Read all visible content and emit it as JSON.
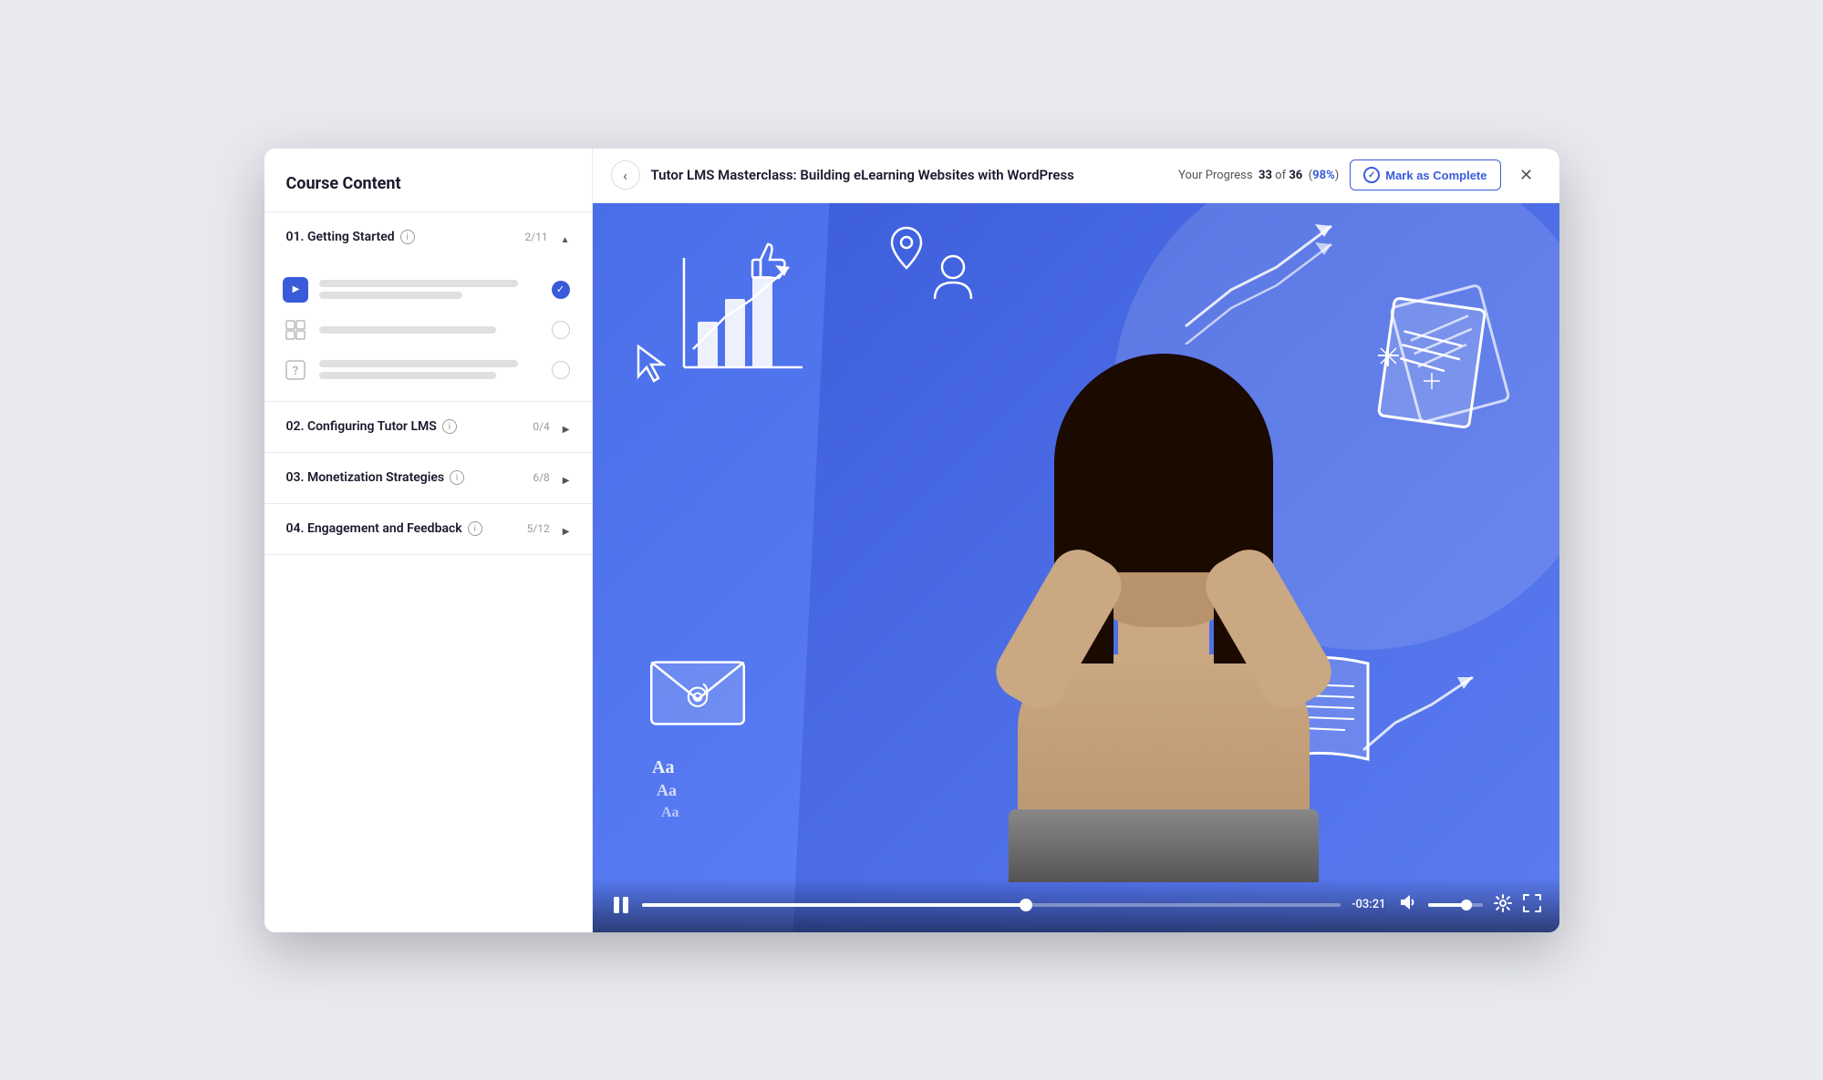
{
  "sidebar": {
    "title": "Course Content",
    "sections": [
      {
        "id": "s1",
        "number": "01.",
        "name": "Getting Started",
        "progress": "2/11",
        "expanded": true,
        "lessons": [
          {
            "type": "video",
            "active": true,
            "checked": true
          },
          {
            "type": "grid",
            "active": false,
            "checked": false
          },
          {
            "type": "quiz",
            "active": false,
            "checked": false
          }
        ]
      },
      {
        "id": "s2",
        "number": "02.",
        "name": "Configuring Tutor LMS",
        "progress": "0/4",
        "expanded": false
      },
      {
        "id": "s3",
        "number": "03.",
        "name": "Monetization Strategies",
        "progress": "6/8",
        "expanded": false
      },
      {
        "id": "s4",
        "number": "04.",
        "name": "Engagement and Feedback",
        "progress": "5/12",
        "expanded": false
      }
    ]
  },
  "video": {
    "title": "Tutor LMS Masterclass: Building eLearning Websites with WordPress",
    "progress_label": "Your Progress",
    "progress_current": "33",
    "progress_total": "36",
    "progress_percent": "98%",
    "mark_complete_label": "Mark as Complete",
    "time_remaining": "-03:21",
    "progress_bar_width": "55",
    "vol_width": "70"
  },
  "icons": {
    "back": "‹",
    "close": "✕",
    "pause": "⏸",
    "volume": "🔊",
    "settings": "⚙",
    "fullscreen": "⛶",
    "check": "✓",
    "info": "i",
    "chevron_up": "▲",
    "chevron_right": "▶"
  }
}
